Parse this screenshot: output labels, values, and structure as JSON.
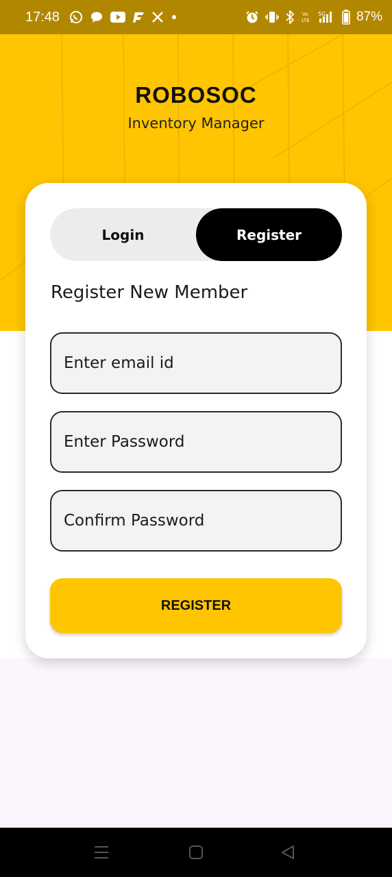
{
  "status_bar": {
    "time": "17:48",
    "battery": "87%",
    "left_icons": [
      "whatsapp-icon",
      "message-icon",
      "youtube-icon",
      "flipboard-icon",
      "x-icon",
      "dot-icon"
    ],
    "right_icons": [
      "alarm-icon",
      "vibrate-icon",
      "bluetooth-icon",
      "volte-icon",
      "signal-5g-icon",
      "battery-icon"
    ],
    "volte_label": "Vo LTE",
    "network_label": "5G"
  },
  "header": {
    "title": "ROBOSOC",
    "subtitle": "Inventory Manager",
    "accent_color": "#ffc500"
  },
  "auth_toggle": {
    "login_label": "Login",
    "register_label": "Register",
    "active": "Register"
  },
  "form": {
    "title": "Register New Member",
    "email_placeholder": "Enter email id",
    "email_value": "",
    "password_placeholder": "Enter Password",
    "password_value": "",
    "confirm_placeholder": "Confirm Password",
    "confirm_value": "",
    "submit_label": "REGISTER"
  },
  "nav_bar": {
    "buttons": [
      "recents-icon",
      "home-icon",
      "back-icon"
    ]
  }
}
